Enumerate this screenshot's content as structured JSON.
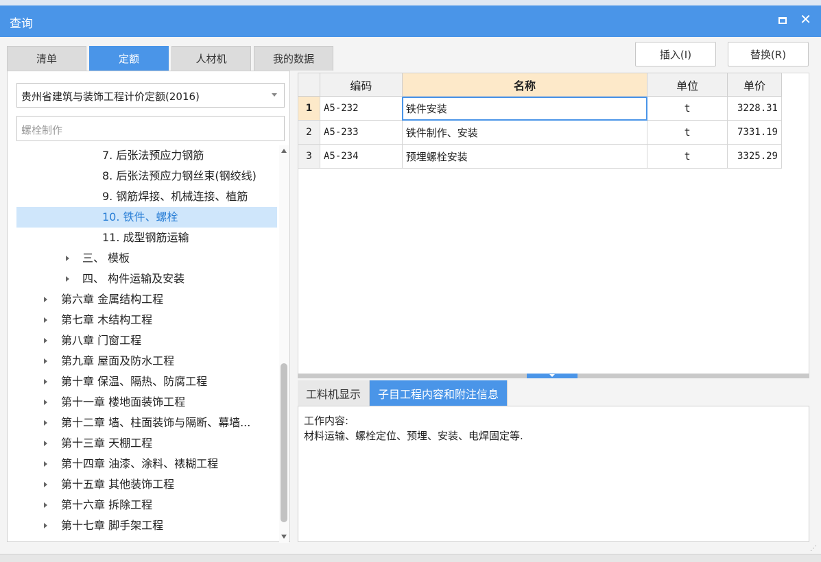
{
  "window": {
    "title": "查询"
  },
  "tabs": [
    {
      "label": "清单",
      "active": false
    },
    {
      "label": "定额",
      "active": true
    },
    {
      "label": "人材机",
      "active": false
    },
    {
      "label": "我的数据",
      "active": false
    }
  ],
  "buttons": {
    "insert": "插入(I)",
    "replace": "替换(R)"
  },
  "left": {
    "dropdown_value": "贵州省建筑与装饰工程计价定额(2016)",
    "search_placeholder": "螺栓制作",
    "tree": [
      {
        "label": "7. 后张法预应力钢筋",
        "expandable": false,
        "selected": false
      },
      {
        "label": "8. 后张法预应力钢丝束(钢绞线)",
        "expandable": false,
        "selected": false
      },
      {
        "label": "9. 钢筋焊接、机械连接、植筋",
        "expandable": false,
        "selected": false
      },
      {
        "label": "10. 铁件、螺栓",
        "expandable": false,
        "selected": true
      },
      {
        "label": "11. 成型钢筋运输",
        "expandable": false,
        "selected": false
      },
      {
        "label": "三、 模板",
        "expandable": true,
        "selected": false
      },
      {
        "label": "四、 构件运输及安装",
        "expandable": true,
        "selected": false
      },
      {
        "label": "第六章 金属结构工程",
        "expandable": true,
        "selected": false
      },
      {
        "label": "第七章 木结构工程",
        "expandable": true,
        "selected": false
      },
      {
        "label": "第八章 门窗工程",
        "expandable": true,
        "selected": false
      },
      {
        "label": "第九章 屋面及防水工程",
        "expandable": true,
        "selected": false
      },
      {
        "label": "第十章 保温、隔热、防腐工程",
        "expandable": true,
        "selected": false
      },
      {
        "label": "第十一章 楼地面装饰工程",
        "expandable": true,
        "selected": false
      },
      {
        "label": "第十二章 墙、柱面装饰与隔断、幕墙...",
        "expandable": true,
        "selected": false
      },
      {
        "label": "第十三章 天棚工程",
        "expandable": true,
        "selected": false
      },
      {
        "label": "第十四章 油漆、涂料、裱糊工程",
        "expandable": true,
        "selected": false
      },
      {
        "label": "第十五章 其他装饰工程",
        "expandable": true,
        "selected": false
      },
      {
        "label": "第十六章 拆除工程",
        "expandable": true,
        "selected": false
      },
      {
        "label": "第十七章 脚手架工程",
        "expandable": true,
        "selected": false
      }
    ]
  },
  "grid": {
    "headers": [
      "编码",
      "名称",
      "单位",
      "单价"
    ],
    "rows": [
      {
        "n": "1",
        "code": "A5-232",
        "name": "铁件安装",
        "unit": "t",
        "price": "3228.31"
      },
      {
        "n": "2",
        "code": "A5-233",
        "name": "铁件制作、安装",
        "unit": "t",
        "price": "7331.19"
      },
      {
        "n": "3",
        "code": "A5-234",
        "name": "预埋螺栓安装",
        "unit": "t",
        "price": "3325.29"
      }
    ]
  },
  "bottom_tabs": [
    {
      "label": "工料机显示",
      "active": false
    },
    {
      "label": "子目工程内容和附注信息",
      "active": true
    }
  ],
  "info": {
    "line1": "工作内容:",
    "line2": "材料运输、螺栓定位、预埋、安装、电焊固定等."
  },
  "colors": {
    "accent": "#4a95e8",
    "selection": "#cfe6fb",
    "header_highlight": "#fde9c9"
  }
}
